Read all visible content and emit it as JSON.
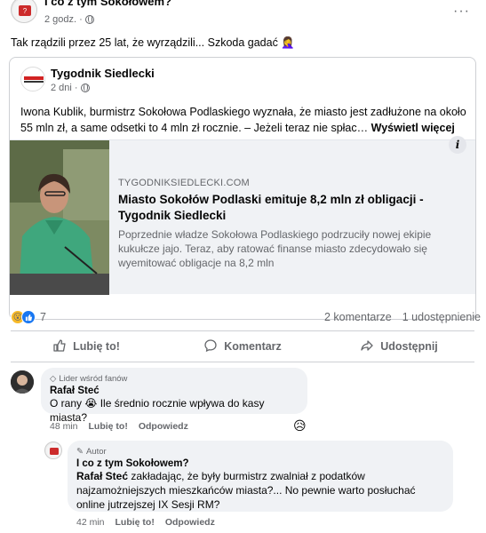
{
  "post": {
    "author": "I co z tym Sokołowem?",
    "time": "2 godz. ·",
    "text": "Tak rządzili przez 25 lat, że wyrządzili... Szkoda gadać 🤦‍♀️"
  },
  "shared": {
    "page_name": "Tygodnik Siedlecki",
    "time": "2 dni ·",
    "body": "Iwona Kublik, burmistrz Sokołowa Podlaskiego  wyznała, że miasto jest zadłużone na około 55 mln zł, a same odsetki to 4 mln zł rocznie. – Jeżeli teraz nie spłac…",
    "see_more": "Wyświetl więcej",
    "logo_text": "Tygodnik Siedlecki",
    "link": {
      "domain": "TYGODNIKSIEDLECKI.COM",
      "title": "Miasto Sokołów Podlaski emituje 8,2 mln zł obligacji - Tygodnik Siedlecki",
      "description": "Poprzednie władze Sokołowa Podlaskiego podrzuciły nowej ekipie kukułcze jajo. Teraz, aby ratować finanse miasto zdecydowało się wyemitować obligacje na 8,2 mln"
    }
  },
  "stats": {
    "reaction_count": "7",
    "comments": "2 komentarze",
    "shares": "1 udostępnienie"
  },
  "actions": {
    "like": "Lubię to!",
    "comment": "Komentarz",
    "share": "Udostępnij"
  },
  "comments": [
    {
      "badge": "Lider wśród fanów",
      "author": "Rafał Steć",
      "text": "O rany 😭 Ile średnio rocznie wpływa do kasy miasta?",
      "time": "48 min",
      "like": "Lubię to!",
      "reply": "Odpowiedz",
      "reaction": "😥"
    },
    {
      "badge": "Autor",
      "author": "I co z tym Sokołowem?",
      "mention": "Rafał Steć",
      "text": " zakładając, że były burmistrz zwalniał z podatków najzamożniejszych mieszkańców miasta?... No pewnie warto posłuchać online jutrzejszej IX Sesji RM?",
      "time": "42 min",
      "like": "Lubię to!",
      "reply": "Odpowiedz"
    }
  ],
  "colors": {
    "text": "#050505",
    "secondary": "#65676b",
    "bubble": "#f0f2f5",
    "like_blue": "#1877f2"
  }
}
